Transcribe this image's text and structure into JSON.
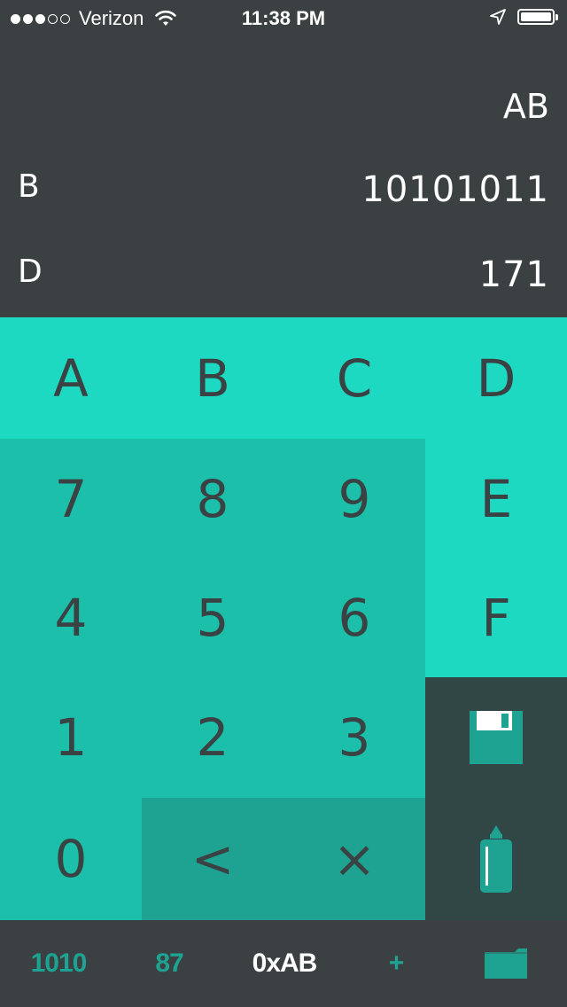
{
  "status": {
    "signal_dots": [
      true,
      true,
      true,
      false,
      false
    ],
    "carrier": "Verizon",
    "time": "11:38 PM",
    "battery_level": 1.0
  },
  "display": {
    "hex_value": "AB",
    "binary_label": "B",
    "binary_value": "10101011",
    "decimal_label": "D",
    "decimal_value": "171"
  },
  "keypad": {
    "a": "A",
    "b": "B",
    "c": "C",
    "d": "D",
    "e": "E",
    "f": "F",
    "seven": "7",
    "eight": "8",
    "nine": "9",
    "four": "4",
    "five": "5",
    "six": "6",
    "one": "1",
    "two": "2",
    "three": "3",
    "zero": "0",
    "backspace": "<",
    "clear": "×"
  },
  "tabs": {
    "binary": "1010",
    "octal": "87",
    "hex": "0xAB",
    "add": "+"
  },
  "icons": {
    "save": "floppy-disk-icon",
    "copy": "glue-bottle-icon",
    "folder": "folder-icon",
    "wifi": "wifi-icon",
    "location": "location-arrow-icon",
    "battery": "battery-icon"
  },
  "colors": {
    "key_light": "#1dd9c2",
    "key_mid": "#1bbfaa",
    "key_dark": "#1ea392",
    "key_slate": "#314746",
    "background": "#3b4142"
  }
}
